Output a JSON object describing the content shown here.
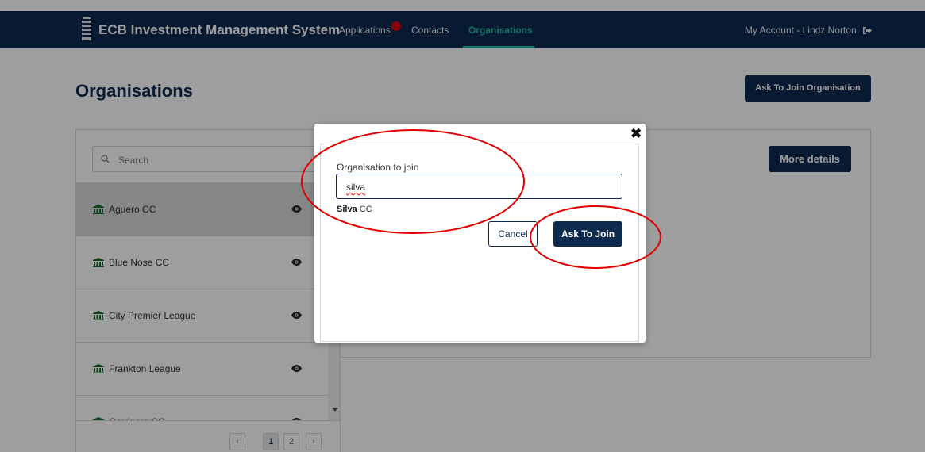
{
  "navbar": {
    "brand": "ECB Investment Management System",
    "links": [
      {
        "label": "Applications"
      },
      {
        "label": "Contacts"
      },
      {
        "label": "Organisations"
      }
    ],
    "account_label": "My Account - Lindz Norton"
  },
  "page": {
    "title": "Organisations",
    "ask_join_org_label": "Ask To Join Organisation",
    "more_details_label": "More details"
  },
  "search": {
    "placeholder": "Search"
  },
  "organisations": [
    {
      "name": "Aguero CC"
    },
    {
      "name": "Blue Nose CC"
    },
    {
      "name": "City Premier League"
    },
    {
      "name": "Frankton League"
    },
    {
      "name": "Gardners CC"
    }
  ],
  "pagination": {
    "pages": [
      "1",
      "2"
    ],
    "current": "1"
  },
  "modal": {
    "field_label": "Organisation to join",
    "field_value": "silva",
    "suggestion_match": "Silva",
    "suggestion_rest": " CC",
    "cancel_label": "Cancel",
    "join_label": "Ask To Join"
  },
  "colors": {
    "brand": "#0d2a4f",
    "accent": "#1fb7a1",
    "notification": "#e10012",
    "annotation": "#e00000"
  },
  "icons": [
    "ecb-logo-icon",
    "notification-dot-icon",
    "sign-out-icon",
    "search-icon",
    "bank-icon",
    "eye-icon",
    "close-icon",
    "chevron-left-icon",
    "chevron-right-icon"
  ]
}
